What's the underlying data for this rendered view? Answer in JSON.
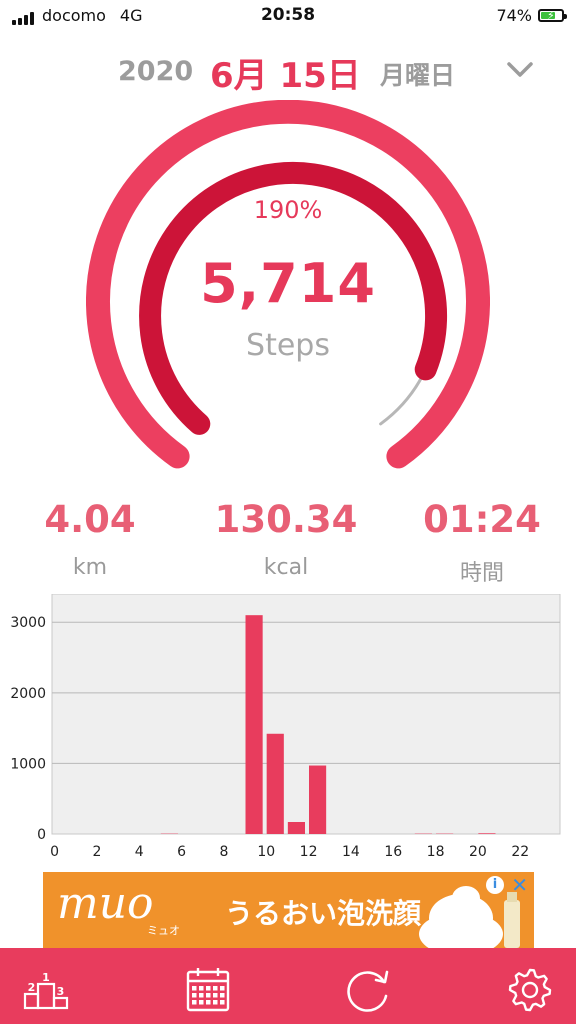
{
  "status_bar": {
    "carrier": "docomo",
    "network": "4G",
    "time": "20:58",
    "battery_percent": "74%",
    "battery_level": 0.74
  },
  "date_header": {
    "year": "2020",
    "month_day": "6月 15日",
    "weekday": "月曜日",
    "dropdown_icon": "chevron-down-icon"
  },
  "goal": {
    "percent": "190%",
    "percent_value": 1.9,
    "steps": "5,714",
    "steps_label": "Steps"
  },
  "stats": [
    {
      "value": "4.04",
      "unit": "km"
    },
    {
      "value": "130.34",
      "unit": "kcal"
    },
    {
      "value": "01:24",
      "unit": "時間"
    }
  ],
  "chart_data": {
    "type": "bar",
    "x": [
      0,
      1,
      2,
      3,
      4,
      5,
      6,
      7,
      8,
      9,
      10,
      11,
      12,
      13,
      14,
      15,
      16,
      17,
      18,
      19,
      20,
      21,
      22,
      23
    ],
    "values": [
      0,
      0,
      0,
      0,
      0,
      5,
      0,
      0,
      0,
      3100,
      1420,
      170,
      970,
      0,
      0,
      0,
      0,
      5,
      5,
      0,
      10,
      0,
      0,
      0
    ],
    "x_tick_labels": [
      "0",
      "2",
      "4",
      "6",
      "8",
      "10",
      "12",
      "14",
      "16",
      "18",
      "20",
      "22"
    ],
    "y_tick_labels": [
      "0",
      "1000",
      "2000",
      "3000"
    ],
    "ylim": [
      0,
      3400
    ],
    "grid": true,
    "bar_color": "#e83c5d"
  },
  "ad": {
    "brand": "muo",
    "brand_kana": "ミュオ",
    "copy": "うるおい泡洗顔",
    "info_icon": "info-icon",
    "close_icon": "close-icon"
  },
  "toolbar": {
    "items": [
      {
        "name": "ranking",
        "icon": "podium-icon"
      },
      {
        "name": "calendar",
        "icon": "calendar-icon"
      },
      {
        "name": "refresh",
        "icon": "refresh-icon"
      },
      {
        "name": "settings",
        "icon": "gear-icon"
      }
    ]
  },
  "colors": {
    "accent": "#e83c5d",
    "accent_dark": "#cc1438",
    "text_gray": "#9c9c9c"
  }
}
